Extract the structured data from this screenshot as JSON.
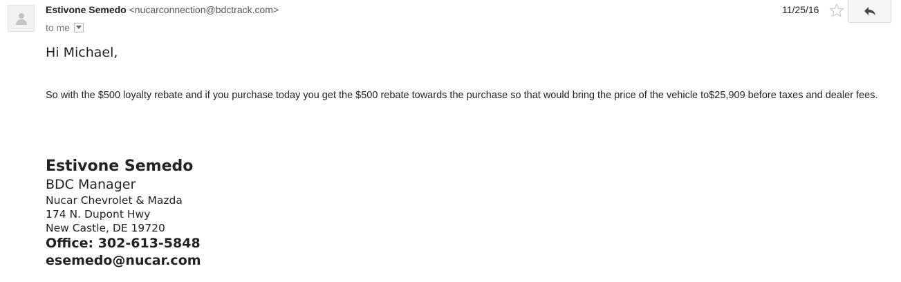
{
  "message": {
    "sender_name": "Estivone Semedo",
    "sender_email": "<nucarconnection@bdctrack.com>",
    "recipient": "to me",
    "date": "11/25/16",
    "greeting": "Hi Michael,",
    "body": "So with the $500 loyalty rebate and if you purchase today you get the $500 rebate towards the purchase so that would bring the price of the vehicle to$25,909 before taxes and dealer fees."
  },
  "signature": {
    "name": "Estivone Semedo",
    "title": "BDC Manager",
    "company": "Nucar Chevrolet & Mazda",
    "address_line1": "174 N. Dupont Hwy",
    "address_line2": "New Castle, DE 19720",
    "office": "Office: 302-613-5848",
    "email": "esemedo@nucar.com"
  },
  "icons": {
    "avatar": "person-icon",
    "caret": "chevron-down-icon",
    "star": "star-icon",
    "reply": "reply-icon"
  }
}
